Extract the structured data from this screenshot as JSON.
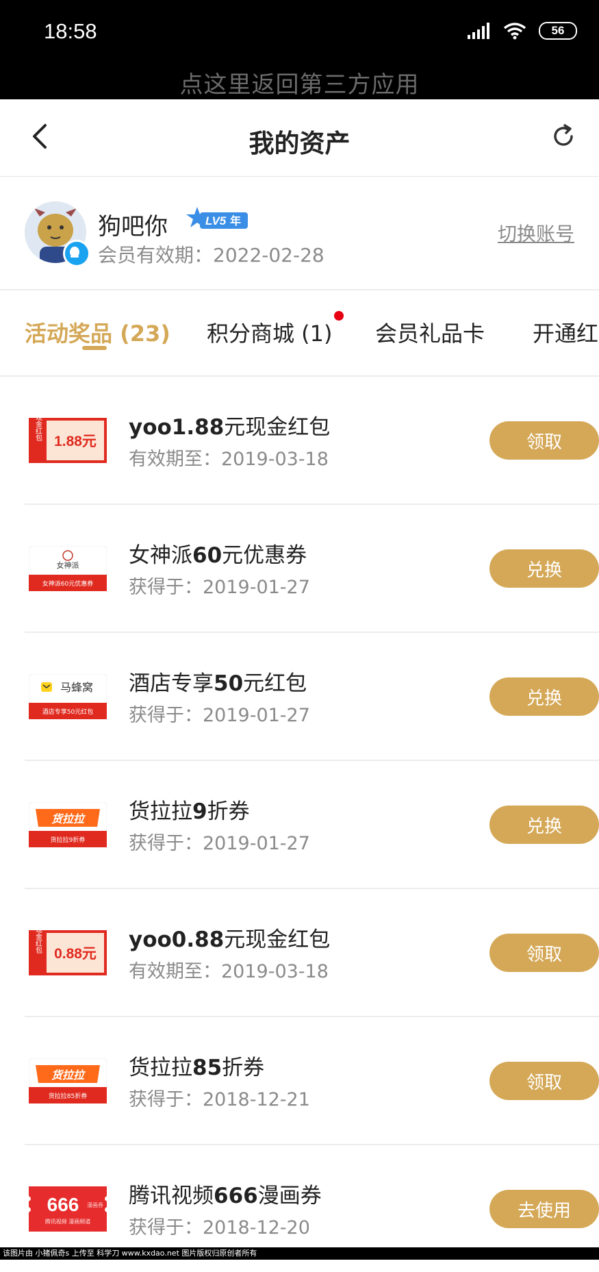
{
  "status_bar": {
    "time": "18:58",
    "battery": "56",
    "back_to_app": "点这里返回第三方应用"
  },
  "nav": {
    "title": "我的资产"
  },
  "user": {
    "name": "狗吧你",
    "vip_level": "LV5",
    "vip_year": "年",
    "expire": "会员有效期：2022-02-28",
    "switch_account": "切换账号"
  },
  "tabs": [
    {
      "label": "活动奖品 (23)",
      "active": true
    },
    {
      "label": "积分商城 (1)",
      "active": false
    },
    {
      "label": "会员礼品卡",
      "active": false
    },
    {
      "label": "开通红",
      "active": false
    }
  ],
  "items": [
    {
      "title_pre": "yoo1.88",
      "title_post": "元现金红包",
      "subtitle": "有效期至：2019-03-18",
      "button": "领取",
      "thumb": "cash-redpacket",
      "thumb_side": "现金红包",
      "thumb_text": "1.88元"
    },
    {
      "title_pre": "女神派",
      "title_bold": "60",
      "title_post": "元优惠券",
      "subtitle": "获得于：2019-01-27",
      "button": "兑换",
      "thumb": "nvshenpai-coupon",
      "thumb_text": "女神派60元优惠券"
    },
    {
      "title_pre": "酒店专享",
      "title_bold": "50",
      "title_post": "元红包",
      "subtitle": "获得于：2019-01-27",
      "button": "兑换",
      "thumb": "mafengwo-coupon",
      "thumb_text": "酒店专享50元红包"
    },
    {
      "title_pre": "货拉拉",
      "title_bold": "9",
      "title_post": "折券",
      "subtitle": "获得于：2019-01-27",
      "button": "兑换",
      "thumb": "huolala-coupon",
      "thumb_text": "货拉拉9折券"
    },
    {
      "title_pre": "yoo0.88",
      "title_post": "元现金红包",
      "subtitle": "有效期至：2019-03-18",
      "button": "领取",
      "thumb": "cash-redpacket",
      "thumb_side": "现金红包",
      "thumb_text": "0.88元"
    },
    {
      "title_pre": "货拉拉",
      "title_bold": "85",
      "title_post": "折券",
      "subtitle": "获得于：2018-12-21",
      "button": "领取",
      "thumb": "huolala-coupon",
      "thumb_text": "货拉拉85折券"
    },
    {
      "title_pre": "腾讯视频",
      "title_bold": "666",
      "title_post": "漫画券",
      "subtitle": "获得于：2018-12-20",
      "button": "去使用",
      "thumb": "tencent-comic-coupon",
      "thumb_text": "666"
    }
  ],
  "thumb_labels": {
    "nvshenpai_logo": "女神派",
    "mafengwo_logo": "马蜂窝",
    "huolala_logo": "货拉拉",
    "tencent_unit": "漫画券",
    "tencent_sub": "腾讯视频 漫画频道"
  },
  "watermark": "该图片由 小猪佩奇s 上传至 科学刀 www.kxdao.net 图片版权归原创者所有",
  "colors": {
    "accent": "#d4a857",
    "red": "#e02a1f",
    "text": "#222222",
    "muted": "#8a8a8a"
  }
}
